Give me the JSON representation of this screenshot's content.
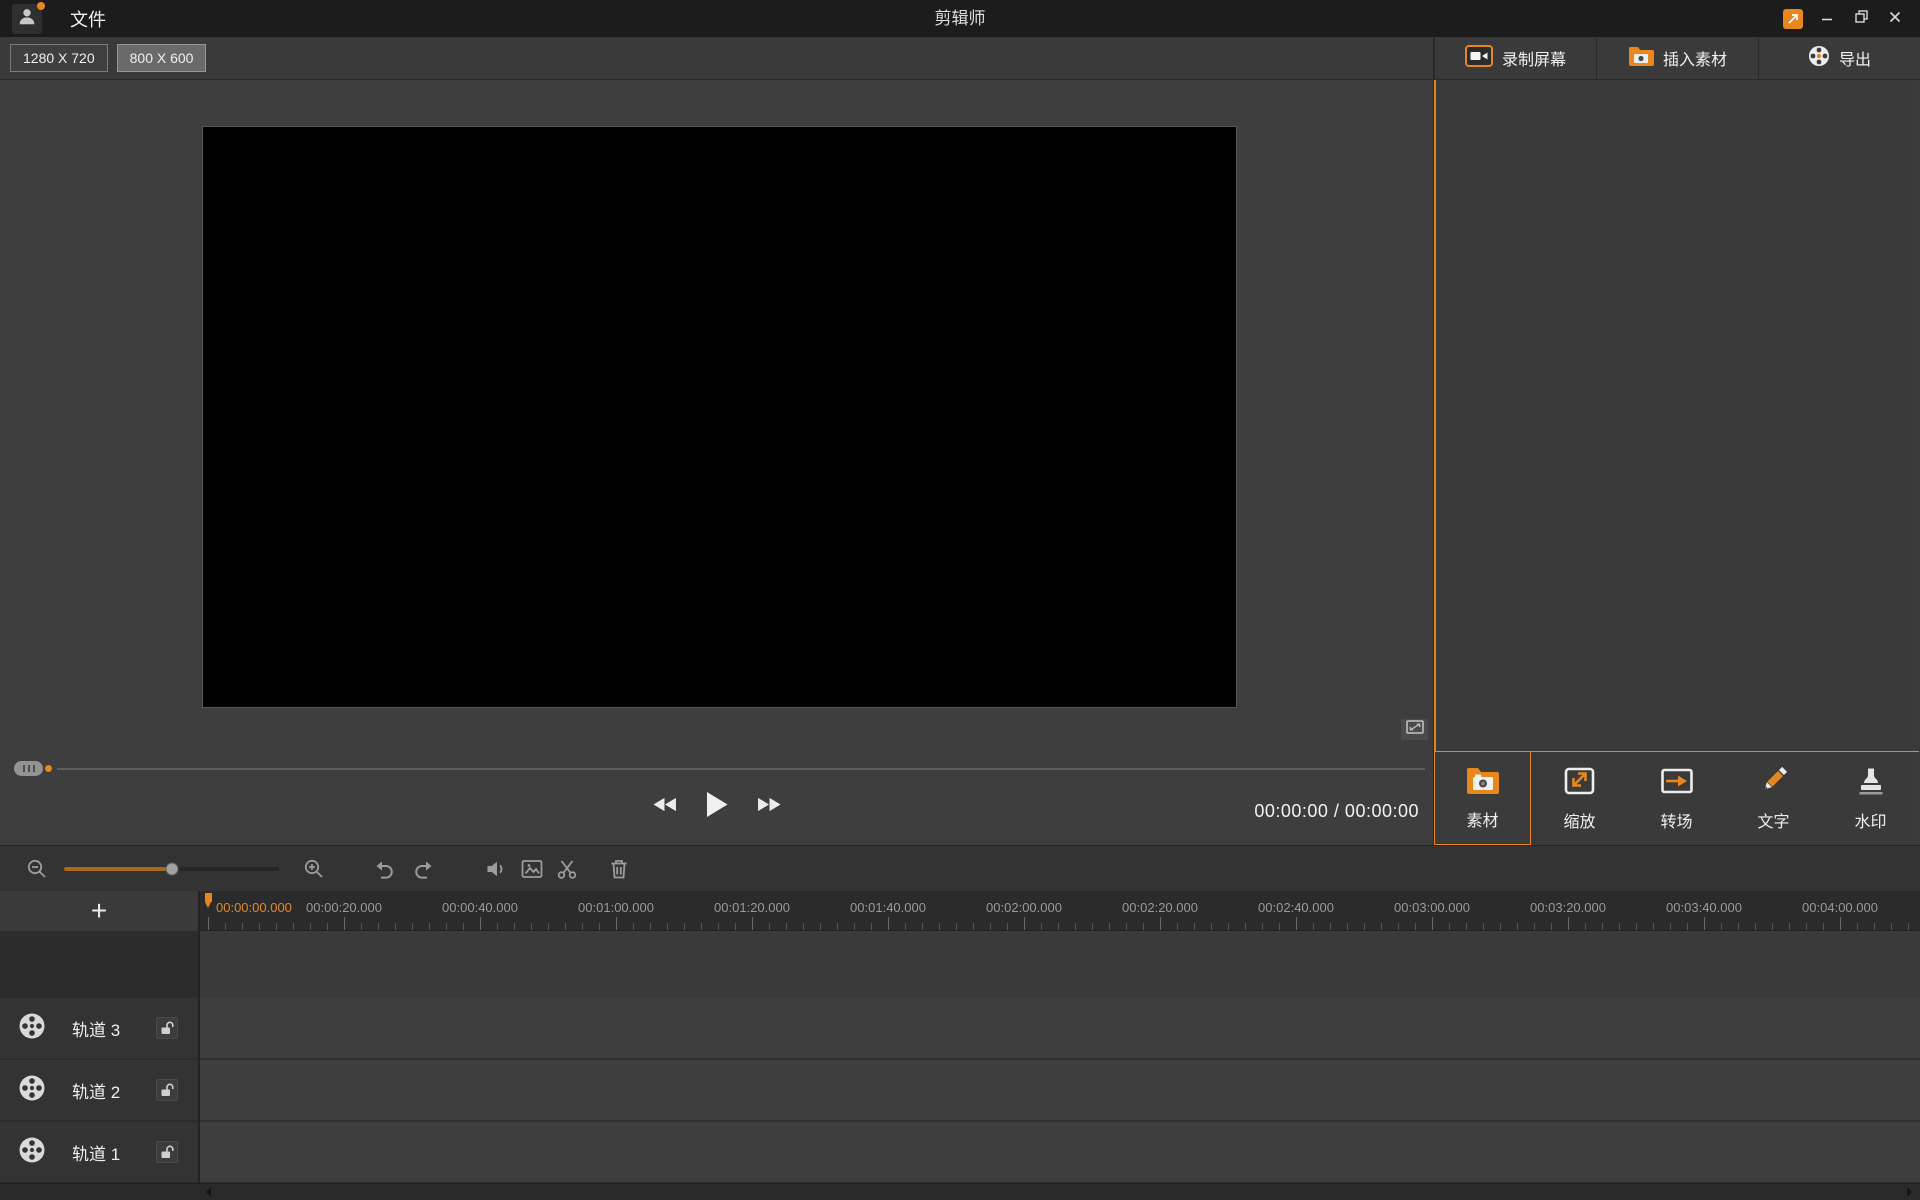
{
  "window": {
    "title": "剪辑师",
    "file_menu": "文件"
  },
  "toolbar": {
    "resolution_720": "1280 X 720",
    "resolution_600": "800 X 600"
  },
  "right_panel": {
    "record_screen": "录制屏幕",
    "insert_material": "插入素材",
    "export": "导出",
    "tabs": {
      "material": "素材",
      "scale": "缩放",
      "transition": "转场",
      "text": "文字",
      "watermark": "水印"
    }
  },
  "preview": {
    "time_display": "00:00:00 / 00:00:00"
  },
  "timeline": {
    "add_track": "+",
    "ruler": [
      "00:00:00.000",
      "00:00:20.000",
      "00:00:40.000",
      "00:01:00.000",
      "00:01:20.000",
      "00:01:40.000",
      "00:02:00.000",
      "00:02:20.000",
      "00:02:40.000",
      "00:03:00.000",
      "00:03:20.000",
      "00:03:40.000",
      "00:04:00.000"
    ],
    "tracks": [
      "轨道 3",
      "轨道 2",
      "轨道 1"
    ]
  },
  "colors": {
    "accent": "#e8871e",
    "titlebar_bg": "#1c1c1c",
    "panel_bg": "#3a3a3a",
    "timeline_bg": "#2b2b2b"
  },
  "icons": {
    "titlebar": [
      "user-avatar-icon",
      "feedback-icon",
      "minimize-icon",
      "restore-icon",
      "close-icon"
    ],
    "panel_header": [
      "record-screen-icon",
      "insert-material-icon",
      "export-reel-icon"
    ],
    "tabs": [
      "material-camera-icon",
      "scale-icon",
      "transition-icon",
      "text-pencil-icon",
      "watermark-stamp-icon"
    ],
    "preview": [
      "fullscreen-icon",
      "seek-handle-icon",
      "rewind-icon",
      "play-icon",
      "fast-forward-icon"
    ],
    "timeline_toolbar": [
      "zoom-out-icon",
      "zoom-slider",
      "zoom-in-icon",
      "undo-icon",
      "redo-icon",
      "volume-icon",
      "frame-icon",
      "scissors-icon",
      "trash-icon"
    ],
    "tracks": [
      "add-track-icon",
      "film-reel-icon",
      "lock-icon"
    ],
    "scrollbar": [
      "scroll-left-icon",
      "scroll-right-icon"
    ]
  }
}
